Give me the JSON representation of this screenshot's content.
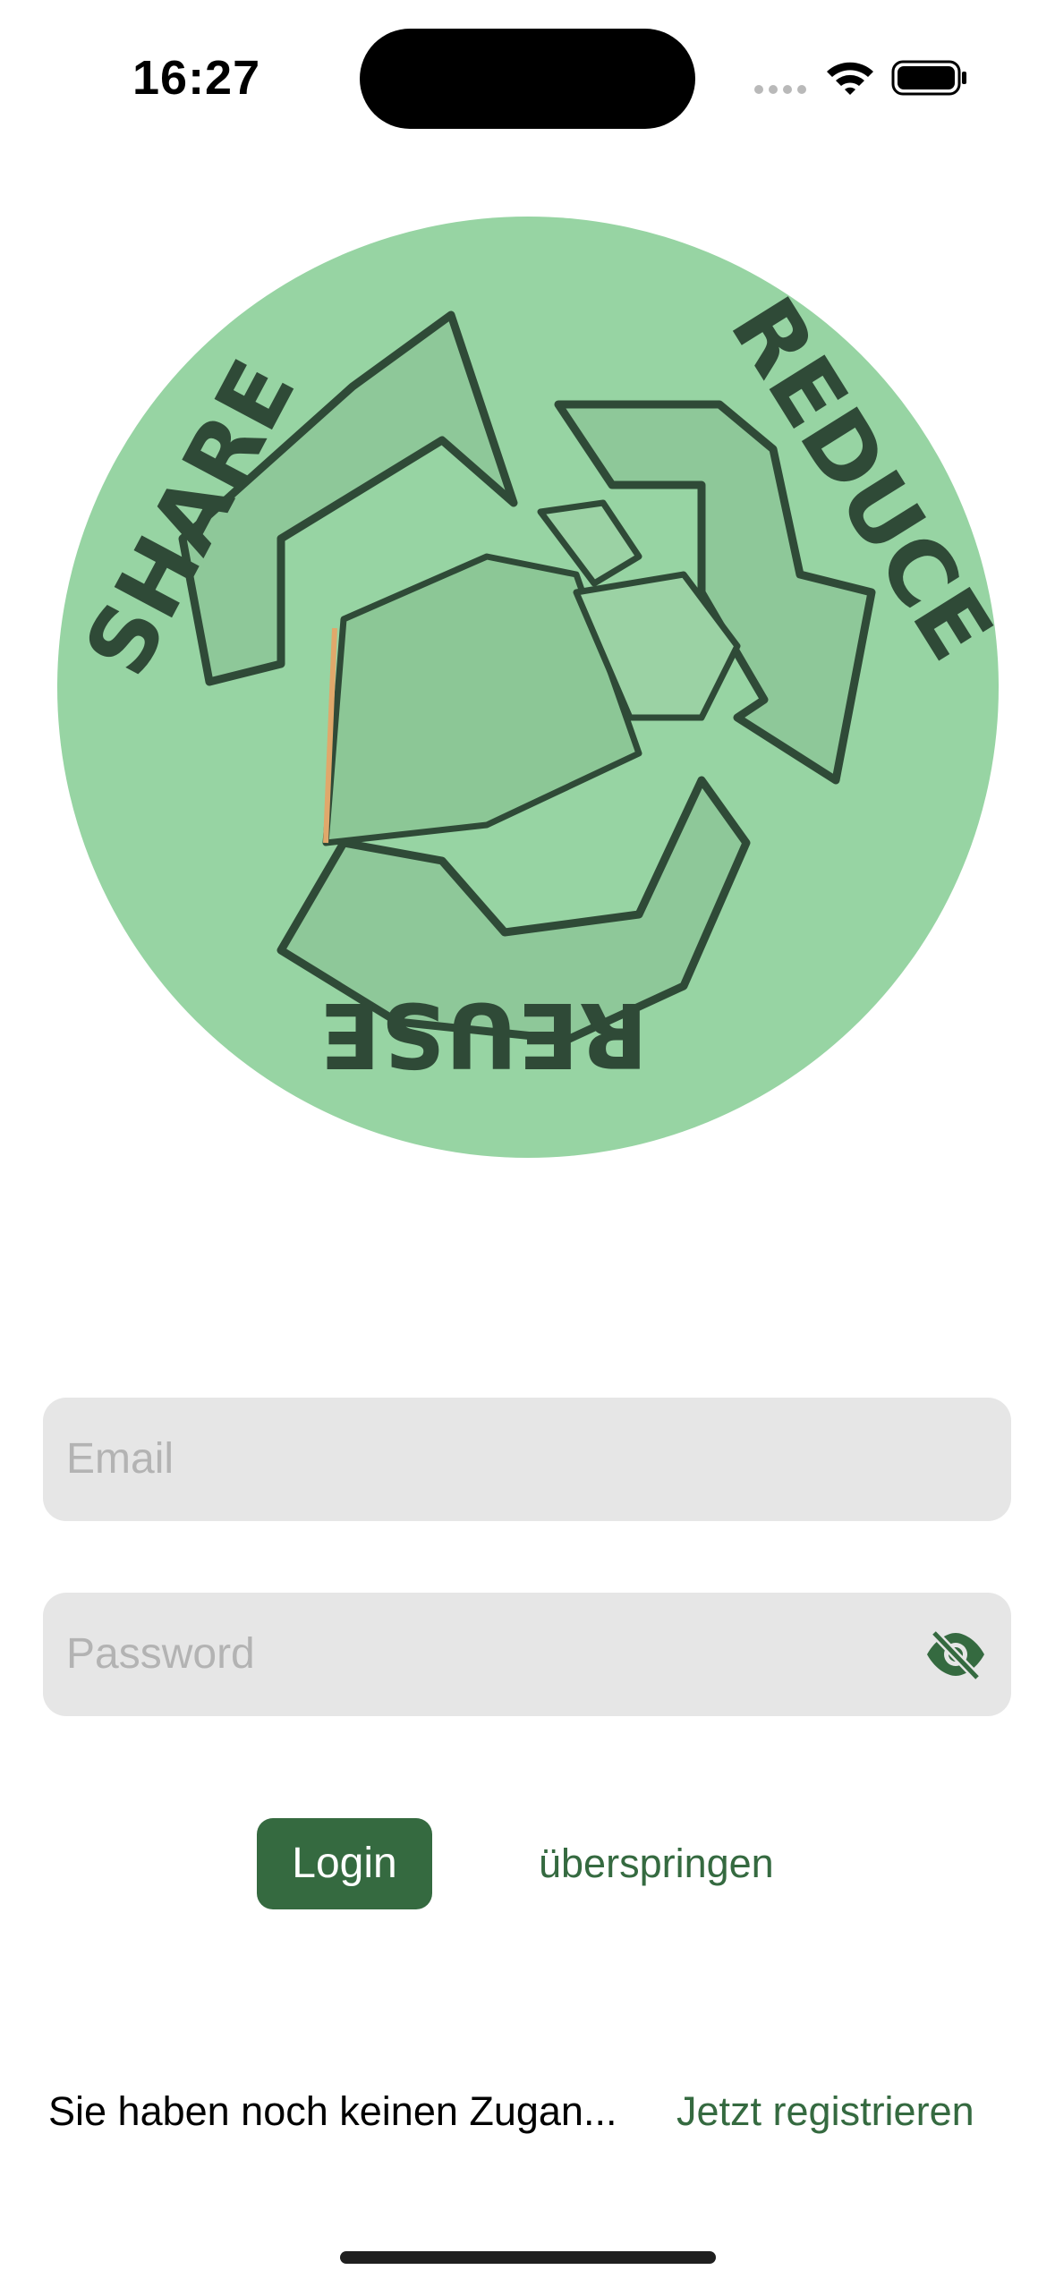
{
  "status_bar": {
    "time": "16:27"
  },
  "logo": {
    "words": [
      "SHARE",
      "REDUCE",
      "REUSE"
    ],
    "colors": {
      "background": "#97d4a3",
      "arrows": "#8ec899",
      "ink": "#2f4a37",
      "accent": "#e0a86b"
    }
  },
  "form": {
    "email_placeholder": "Email",
    "password_placeholder": "Password",
    "password_toggle_icon": "eye-slash-icon"
  },
  "actions": {
    "login_label": "Login",
    "skip_label": "überspringen"
  },
  "footer": {
    "no_account_text": "Sie haben noch keinen Zugan...",
    "register_label": "Jetzt registrieren"
  },
  "theme": {
    "accent": "#356a40",
    "field_bg": "#e6e6e6",
    "placeholder": "#b3b3b3"
  }
}
